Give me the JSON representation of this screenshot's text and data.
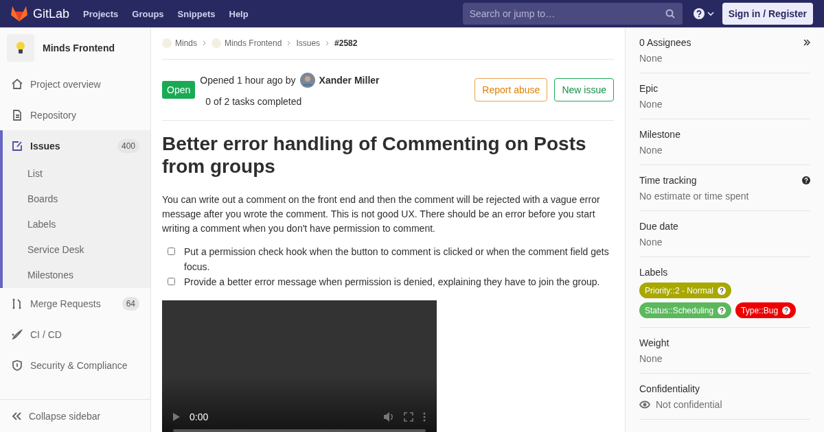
{
  "navbar": {
    "brand": "GitLab",
    "links": [
      "Projects",
      "Groups",
      "Snippets",
      "Help"
    ],
    "search": {
      "placeholder": "Search or jump to…"
    },
    "sign_in": "Sign in / Register"
  },
  "sidebar": {
    "project": "Minds Frontend",
    "items": [
      {
        "label": "Project overview",
        "selected": false
      },
      {
        "label": "Repository",
        "selected": false
      },
      {
        "label": "Issues",
        "count": "400",
        "selected": true,
        "children": [
          {
            "label": "List",
            "selected": false
          },
          {
            "label": "Boards",
            "selected": false
          },
          {
            "label": "Labels",
            "selected": false
          },
          {
            "label": "Service Desk",
            "selected": false
          },
          {
            "label": "Milestones",
            "selected": false
          }
        ]
      },
      {
        "label": "Merge Requests",
        "count": "64",
        "selected": false
      },
      {
        "label": "CI / CD",
        "selected": false
      },
      {
        "label": "Security & Compliance",
        "selected": false
      }
    ],
    "collapse": "Collapse sidebar"
  },
  "breadcrumbs": [
    {
      "label": "Minds",
      "avatar": true,
      "current": false
    },
    {
      "label": "Minds Frontend",
      "avatar": true,
      "current": false
    },
    {
      "label": "Issues",
      "avatar": false,
      "current": false
    },
    {
      "label": "#2582",
      "avatar": false,
      "current": true
    }
  ],
  "issue": {
    "status": "Open",
    "opened": "Opened 1 hour ago by",
    "author": "Xander Miller",
    "tasks": "0 of 2 tasks completed",
    "buttons": [
      {
        "label": "Report abuse",
        "kind": "warning"
      },
      {
        "label": "New issue",
        "kind": "success"
      }
    ],
    "title": "Better error handling of Commenting on Posts from groups",
    "description": "You can write out a comment on the front end and then the comment will be rejected with a vague error message after you wrote the comment. This is not good UX. There should be an error before you start writing a comment when you don't have permission to comment.",
    "task_list": [
      {
        "label": "Put a permission check hook when the button to comment is clicked or when the comment field gets focus.",
        "checked": false
      },
      {
        "label": "Provide a better error message when permission is denied, explaining they have to join the group.",
        "checked": false
      }
    ],
    "video": {
      "time": "0:00"
    }
  },
  "right_sidebar": {
    "blocks": [
      {
        "kind": "text",
        "title": "0 Assignees",
        "value": "None",
        "collapse": true
      },
      {
        "kind": "text",
        "title": "Epic",
        "value": "None"
      },
      {
        "kind": "text",
        "title": "Milestone",
        "value": "None"
      },
      {
        "kind": "text",
        "title": "Time tracking",
        "value": "No estimate or time spent",
        "help": true
      },
      {
        "kind": "text",
        "title": "Due date",
        "value": "None"
      },
      {
        "kind": "labels",
        "title": "Labels",
        "labels": [
          {
            "text": "Priority::2 - Normal",
            "color": "#a8a800"
          },
          {
            "text": "Status::Scheduling",
            "color": "#5cb85c"
          },
          {
            "text": "Type::Bug",
            "color": "#ee0000"
          }
        ]
      },
      {
        "kind": "text",
        "title": "Weight",
        "value": "None"
      },
      {
        "kind": "eye",
        "title": "Confidentiality",
        "value": "Not confidential"
      }
    ]
  }
}
